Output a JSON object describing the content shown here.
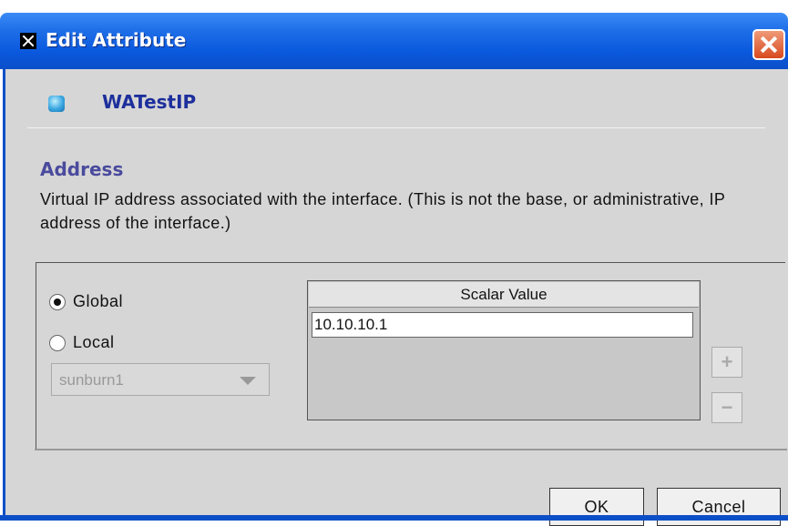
{
  "window": {
    "title": "Edit Attribute",
    "close_icon": "close-x-icon"
  },
  "header": {
    "object_icon": "cube-icon",
    "object_name": "WATestIP"
  },
  "attribute": {
    "name": "Address",
    "description": "Virtual IP address associated with the interface. (This is not the base, or administrative, IP address of the interface.)"
  },
  "scope": {
    "options": [
      {
        "label": "Global",
        "checked": true
      },
      {
        "label": "Local",
        "checked": false
      }
    ],
    "host_select": {
      "value": "sunburn1",
      "enabled": false
    }
  },
  "value_table": {
    "header": "Scalar Value",
    "rows": [
      "10.10.10.1"
    ]
  },
  "side_buttons": {
    "add_label": "+",
    "remove_label": "−"
  },
  "actions": {
    "ok_label": "OK",
    "cancel_label": "Cancel"
  },
  "colors": {
    "titlebar": "#0a58dd",
    "dialog_bg": "#d6d6d6",
    "heading": "#1d2f9c"
  }
}
